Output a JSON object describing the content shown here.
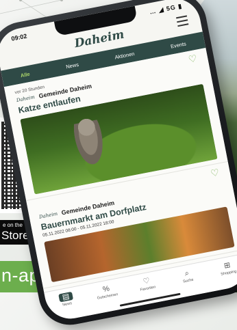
{
  "background": {
    "accent_color": "#6cae4d",
    "brand_color": "#2f4a46"
  },
  "store_badge": {
    "small_text": "e on the",
    "big_text": "Store"
  },
  "url_bar": {
    "text": "n-app.at"
  },
  "phone": {
    "status": {
      "time": "09:02",
      "icons": "… ◢ 5G ▮"
    },
    "app_title": "Daheim",
    "tabs": [
      {
        "label": "Alle",
        "active": true
      },
      {
        "label": "News"
      },
      {
        "label": "Aktionen"
      },
      {
        "label": "Events"
      }
    ],
    "feed": [
      {
        "meta": "vor 20 Stunden",
        "source_logo": "Daheim",
        "source_name": "Gemeinde Daheim",
        "title": "Katze entlaufen",
        "date": "",
        "image": "cat"
      },
      {
        "meta": "",
        "source_logo": "Daheim",
        "source_name": "Gemeinde Daheim",
        "title": "Bauernmarkt am Dorfplatz",
        "date": "05.11.2022 08:00 - 05.11.2022 18:00",
        "image": "market"
      }
    ],
    "bottom_nav": [
      {
        "label": "News",
        "icon": "▤",
        "icon_name": "news-icon",
        "active": true
      },
      {
        "label": "Gutscheinen",
        "icon": "%",
        "icon_name": "percent-icon"
      },
      {
        "label": "Favoriten",
        "icon": "♡",
        "icon_name": "heart-icon"
      },
      {
        "label": "Suche",
        "icon": "⌕",
        "icon_name": "search-icon"
      },
      {
        "label": "Shopping",
        "icon": "⊞",
        "icon_name": "cart-icon"
      }
    ]
  }
}
